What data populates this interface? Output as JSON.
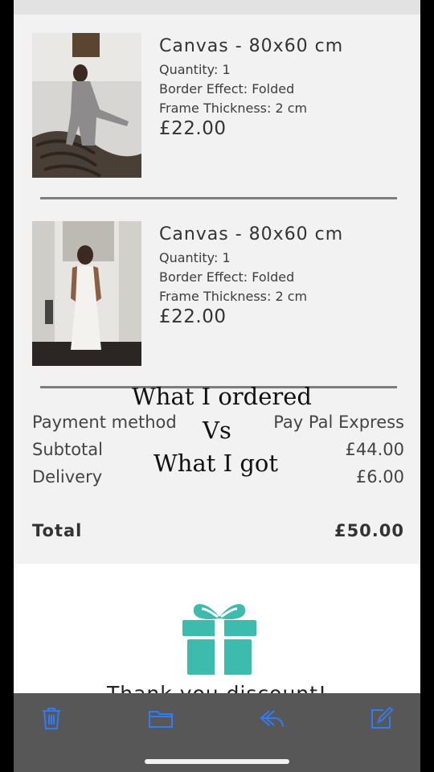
{
  "order": {
    "items": [
      {
        "title": "Canvas - 80x60 cm",
        "quantity": "Quantity: 1",
        "border": "Border Effect: Folded",
        "frame": "Frame Thickness: 2 cm",
        "price": "£22.00"
      },
      {
        "title": "Canvas - 80x60 cm",
        "quantity": "Quantity: 1",
        "border": "Border Effect: Folded",
        "frame": "Frame Thickness: 2 cm",
        "price": "£22.00"
      }
    ],
    "summary": {
      "payment_label": "Payment method",
      "payment_value": "Pay Pal Express",
      "subtotal_label": "Subtotal",
      "subtotal_value": "£44.00",
      "delivery_label": "Delivery",
      "delivery_value": "£6.00",
      "total_label": "Total",
      "total_value": "£50.00"
    }
  },
  "overlay_caption": {
    "line1": "What I ordered",
    "line2": "Vs",
    "line3": "What I got"
  },
  "promo": {
    "icon": "gift-icon",
    "text": "Thank you discount!"
  },
  "toolbar": {
    "icons": [
      "trash-icon",
      "folder-icon",
      "reply-icon",
      "compose-icon"
    ]
  },
  "colors": {
    "accent_teal": "#3dbbad",
    "toolbar_blue": "#2f7cf6",
    "toolbar_bg": "#575757"
  }
}
